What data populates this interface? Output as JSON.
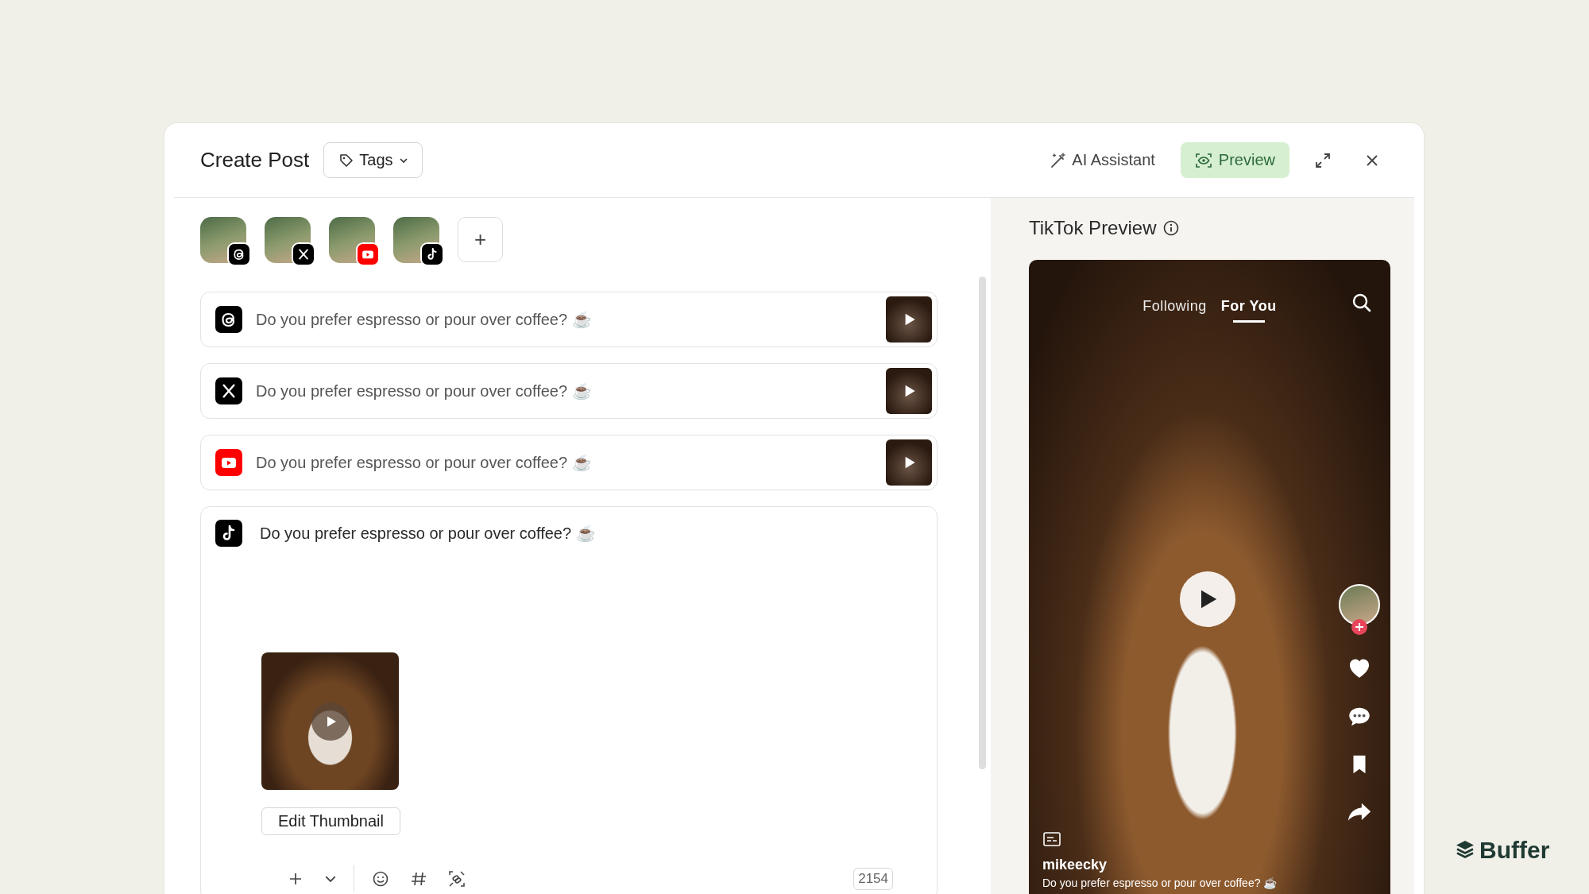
{
  "header": {
    "title": "Create Post",
    "tags_button": "Tags",
    "ai_assistant": "AI Assistant",
    "preview_button": {
      "label": "Preview",
      "selected": true
    }
  },
  "accounts": [
    {
      "kind": "threads"
    },
    {
      "kind": "x"
    },
    {
      "kind": "youtube"
    },
    {
      "kind": "tiktok"
    }
  ],
  "add_account": "+",
  "posts": [
    {
      "kind": "threads",
      "text": "Do you prefer espresso or pour over coffee? ☕",
      "expanded": false
    },
    {
      "kind": "x",
      "text": "Do you prefer espresso or pour over coffee? ☕",
      "expanded": false
    },
    {
      "kind": "youtube",
      "text": "Do you prefer espresso or pour over coffee? ☕",
      "expanded": false
    },
    {
      "kind": "tiktok",
      "text": "Do you prefer espresso or pour over coffee? ☕",
      "expanded": true,
      "thumbnail_button": "Edit Thumbnail",
      "char_count": "2154"
    }
  ],
  "preview": {
    "title": "TikTok Preview",
    "tabs": [
      {
        "label": "Following",
        "selected": false
      },
      {
        "label": "For You",
        "selected": true
      }
    ],
    "username": "mikeecky",
    "caption": "Do you prefer espresso or pour over coffee? ☕"
  },
  "brand": "Buffer"
}
